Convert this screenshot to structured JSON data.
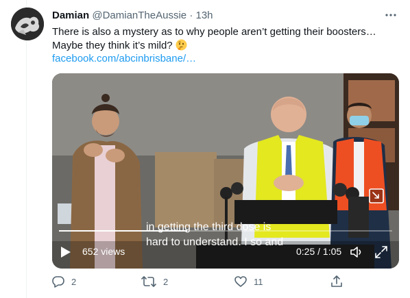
{
  "tweet": {
    "author_name": "Damian",
    "author_handle": "@DamianTheAussie",
    "separator": "·",
    "time": "13h",
    "text_line1": "There is also a mystery as to why people aren’t getting their boosters…",
    "text_line2": "Maybe they think it’s mild?",
    "emoji_name": "thinking-face-emoji",
    "link": "facebook.com/abcinbrisbane/…"
  },
  "video": {
    "caption_line1": "in getting the third dose is",
    "caption_line2": "hard to understand. I so and",
    "views": "652 views",
    "timecode": "0:25 / 1:05",
    "progress_fraction": 0.385
  },
  "actions": {
    "reply_count": "2",
    "retweet_count": "2",
    "like_count": "11"
  },
  "colors": {
    "link": "#1d9bf0",
    "secondary_text": "#536471",
    "vest_yellow": "#e3e81f",
    "vest_orange": "#ee4f22"
  }
}
